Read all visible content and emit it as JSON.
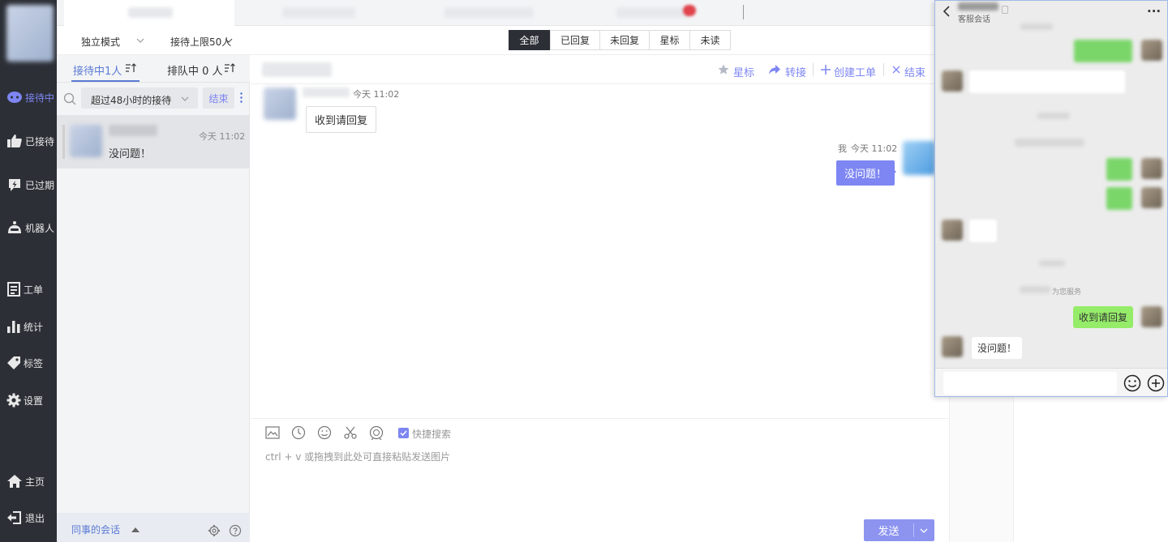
{
  "rail": {
    "items": [
      {
        "label": "接待中",
        "icon": "chat-bubble-icon"
      },
      {
        "label": "已接待",
        "icon": "thumbs-up-icon"
      },
      {
        "label": "已过期",
        "icon": "flash-icon"
      },
      {
        "label": "机器人",
        "icon": "robot-icon"
      },
      {
        "label": "工单",
        "icon": "ticket-icon"
      },
      {
        "label": "统计",
        "icon": "bar-chart-icon"
      },
      {
        "label": "标签",
        "icon": "tag-icon"
      },
      {
        "label": "设置",
        "icon": "gear-icon"
      },
      {
        "label": "主页",
        "icon": "home-icon"
      },
      {
        "label": "退出",
        "icon": "logout-icon"
      }
    ],
    "accent": "#7d86f2"
  },
  "subbar": {
    "mode": "独立模式",
    "limit": "接待上限50人",
    "filters": [
      "全部",
      "已回复",
      "未回复",
      "星标",
      "未读"
    ],
    "active_filter": "全部"
  },
  "sessions": {
    "tab_serving": "接待中1人",
    "tab_queue": "排队中 0 人",
    "search_filter": "超过48小时的接待",
    "end_label": "结束",
    "items": [
      {
        "time": "今天 11:02",
        "preview": "没问题！"
      }
    ],
    "colleague_label": "同事的会话"
  },
  "chat": {
    "actions": {
      "star": "星标",
      "transfer": "转接",
      "create_ticket": "创建工单",
      "end": "结束"
    },
    "messages": [
      {
        "side": "left",
        "time": "今天 11:02",
        "text": "收到请回复"
      },
      {
        "side": "right",
        "sender": "我",
        "time": "今天 11:02",
        "text": "没问题！"
      }
    ],
    "toolbar": {
      "quick_search": "快捷搜索",
      "quick_search_checked": true
    },
    "input_placeholder": "ctrl + v 或拖拽到此处可直接粘贴发送图片",
    "send_label": "发送",
    "accent": "#7d86f2"
  },
  "popup": {
    "subtitle": "客服会话",
    "served_label": "为您服务",
    "messages": [
      {
        "side": "right",
        "text": "收到请回复"
      },
      {
        "side": "left",
        "text": "没问题！"
      }
    ],
    "bubble_green": "#95ec69"
  }
}
